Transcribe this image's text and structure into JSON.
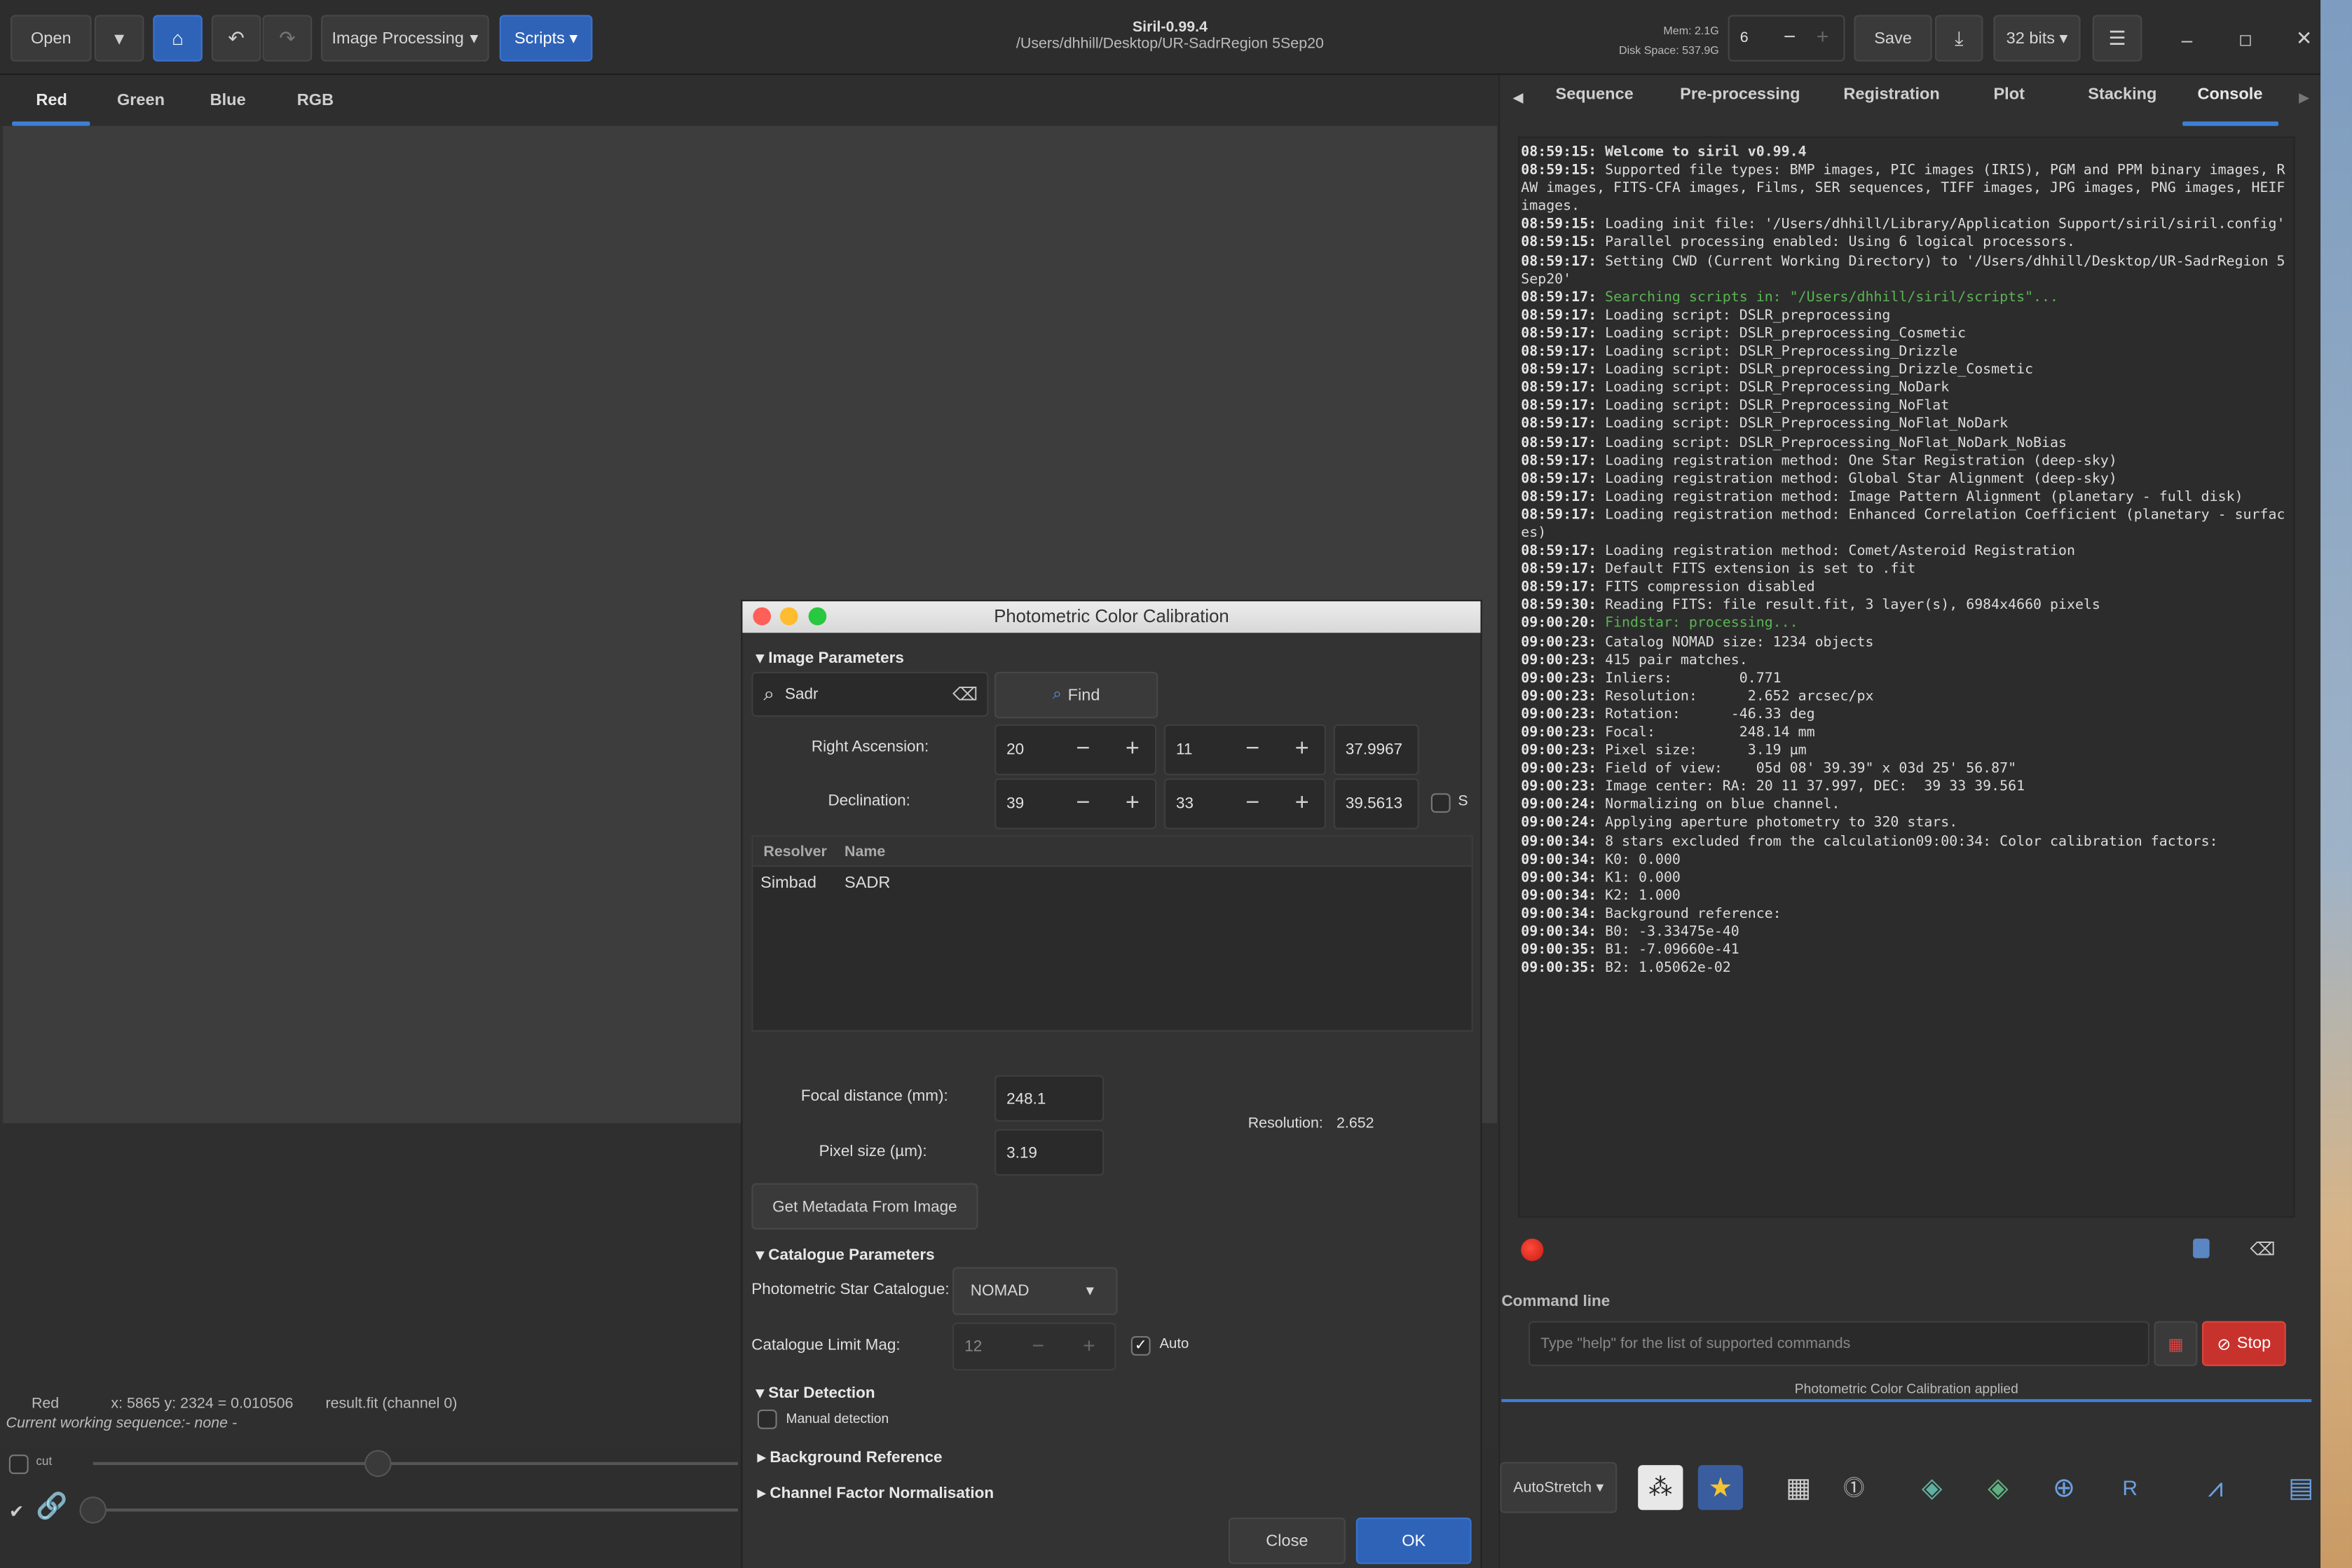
{
  "header": {
    "open": "Open",
    "image_processing": "Image Processing",
    "scripts": "Scripts",
    "title": "Siril-0.99.4",
    "path": "/Users/dhhill/Desktop/UR-SadrRegion 5Sep20",
    "mem": "Mem: 2.1G",
    "disk": "Disk Space: 537.9G",
    "threads": "6",
    "save": "Save",
    "bits": "32 bits"
  },
  "left_tabs": [
    "Red",
    "Green",
    "Blue",
    "RGB"
  ],
  "right_tabs": [
    "Sequence",
    "Pre-processing",
    "Registration",
    "Plot",
    "Stacking",
    "Console"
  ],
  "console_lines": [
    {
      "t": "08:59:15:",
      "m": "Welcome to siril v0.99.4",
      "bold": true
    },
    {
      "t": "08:59:15:",
      "m": "Supported file types: BMP images, PIC images (IRIS), PGM and PPM binary images, RAW images, FITS-CFA images, Films, SER sequences, TIFF images, JPG images, PNG images, HEIF images."
    },
    {
      "t": "08:59:15:",
      "m": "Loading init file: '/Users/dhhill/Library/Application Support/siril/siril.config'"
    },
    {
      "t": "08:59:15:",
      "m": "Parallel processing enabled: Using 6 logical processors."
    },
    {
      "t": "08:59:17:",
      "m": "Setting CWD (Current Working Directory) to '/Users/dhhill/Desktop/UR-SadrRegion 5Sep20'"
    },
    {
      "t": "08:59:17:",
      "m": "Searching scripts in: \"/Users/dhhill/siril/scripts\"...",
      "green": true
    },
    {
      "t": "08:59:17:",
      "m": "Loading script: DSLR_preprocessing"
    },
    {
      "t": "08:59:17:",
      "m": "Loading script: DSLR_preprocessing_Cosmetic"
    },
    {
      "t": "08:59:17:",
      "m": "Loading script: DSLR_Preprocessing_Drizzle"
    },
    {
      "t": "08:59:17:",
      "m": "Loading script: DSLR_preprocessing_Drizzle_Cosmetic"
    },
    {
      "t": "08:59:17:",
      "m": "Loading script: DSLR_Preprocessing_NoDark"
    },
    {
      "t": "08:59:17:",
      "m": "Loading script: DSLR_Preprocessing_NoFlat"
    },
    {
      "t": "08:59:17:",
      "m": "Loading script: DSLR_Preprocessing_NoFlat_NoDark"
    },
    {
      "t": "08:59:17:",
      "m": "Loading script: DSLR_Preprocessing_NoFlat_NoDark_NoBias"
    },
    {
      "t": "08:59:17:",
      "m": "Loading registration method: One Star Registration (deep-sky)"
    },
    {
      "t": "08:59:17:",
      "m": "Loading registration method: Global Star Alignment (deep-sky)"
    },
    {
      "t": "08:59:17:",
      "m": "Loading registration method: Image Pattern Alignment (planetary - full disk)"
    },
    {
      "t": "08:59:17:",
      "m": "Loading registration method: Enhanced Correlation Coefficient (planetary - surfaces)"
    },
    {
      "t": "08:59:17:",
      "m": "Loading registration method: Comet/Asteroid Registration"
    },
    {
      "t": "08:59:17:",
      "m": "Default FITS extension is set to .fit"
    },
    {
      "t": "08:59:17:",
      "m": "FITS compression disabled"
    },
    {
      "t": "08:59:30:",
      "m": "Reading FITS: file result.fit, 3 layer(s), 6984x4660 pixels"
    },
    {
      "t": "09:00:20:",
      "m": "Findstar: processing...",
      "green": true
    },
    {
      "t": "09:00:23:",
      "m": "Catalog NOMAD size: 1234 objects"
    },
    {
      "t": "09:00:23:",
      "m": "415 pair matches."
    },
    {
      "t": "09:00:23:",
      "m": "Inliers:        0.771"
    },
    {
      "t": "09:00:23:",
      "m": "Resolution:      2.652 arcsec/px"
    },
    {
      "t": "09:00:23:",
      "m": "Rotation:      -46.33 deg"
    },
    {
      "t": "09:00:23:",
      "m": "Focal:          248.14 mm"
    },
    {
      "t": "09:00:23:",
      "m": "Pixel size:      3.19 µm"
    },
    {
      "t": "09:00:23:",
      "m": "Field of view:    05d 08' 39.39\" x 03d 25' 56.87\""
    },
    {
      "t": "09:00:23:",
      "m": "Image center: RA: 20 11 37.997, DEC:  39 33 39.561"
    },
    {
      "t": "09:00:24:",
      "m": "Normalizing on blue channel."
    },
    {
      "t": "09:00:24:",
      "m": "Applying aperture photometry to 320 stars."
    },
    {
      "t": "09:00:34:",
      "m": "8 stars excluded from the calculation09:00:34: Color calibration factors:"
    },
    {
      "t": "09:00:34:",
      "m": "K0: 0.000"
    },
    {
      "t": "09:00:34:",
      "m": "K1: 0.000"
    },
    {
      "t": "09:00:34:",
      "m": "K2: 1.000"
    },
    {
      "t": "09:00:34:",
      "m": "Background reference:"
    },
    {
      "t": "09:00:34:",
      "m": "B0: -3.33475e-40"
    },
    {
      "t": "09:00:35:",
      "m": "B1: -7.09660e-41"
    },
    {
      "t": "09:00:35:",
      "m": "B2: 1.05062e-02"
    }
  ],
  "command": {
    "label": "Command line",
    "placeholder": "Type \"help\" for the list of supported commands",
    "stop": "Stop",
    "status": "Photometric Color Calibration applied"
  },
  "status": {
    "channel": "Red",
    "coords": "x: 5865 y: 2324 = 0.010506",
    "file": "result.fit (channel 0)",
    "sequence": "Current working sequence:- none -",
    "cut": "cut"
  },
  "toolbar": {
    "autostretch": "AutoStretch"
  },
  "dialog": {
    "title": "Photometric Color Calibration",
    "image_params": "Image Parameters",
    "search_value": "Sadr",
    "find": "Find",
    "ra_label": "Right Ascension:",
    "ra": [
      "20",
      "11",
      "37.9967"
    ],
    "dec_label": "Declination:",
    "dec": [
      "39",
      "33",
      "39.5613"
    ],
    "s_label": "S",
    "resolver_header": "Resolver",
    "name_header": "Name",
    "resolver": "Simbad",
    "name": "SADR",
    "focal_label": "Focal distance (mm):",
    "focal": "248.1",
    "pixel_label": "Pixel size (µm):",
    "pixel": "3.19",
    "resolution_label": "Resolution:",
    "resolution": "2.652",
    "metadata_btn": "Get Metadata From Image",
    "catalogue_params": "Catalogue Parameters",
    "catalogue_label": "Photometric Star Catalogue:",
    "catalogue": "NOMAD",
    "limit_label": "Catalogue Limit Mag:",
    "limit": "12",
    "auto": "Auto",
    "star_detection": "Star Detection",
    "manual": "Manual detection",
    "background": "Background Reference",
    "normalisation": "Channel Factor Normalisation",
    "close": "Close",
    "ok": "OK"
  },
  "colors": {
    "accent": "#3d7fd6",
    "stop": "#c8322d",
    "find_icon": "#5a8fd8"
  }
}
